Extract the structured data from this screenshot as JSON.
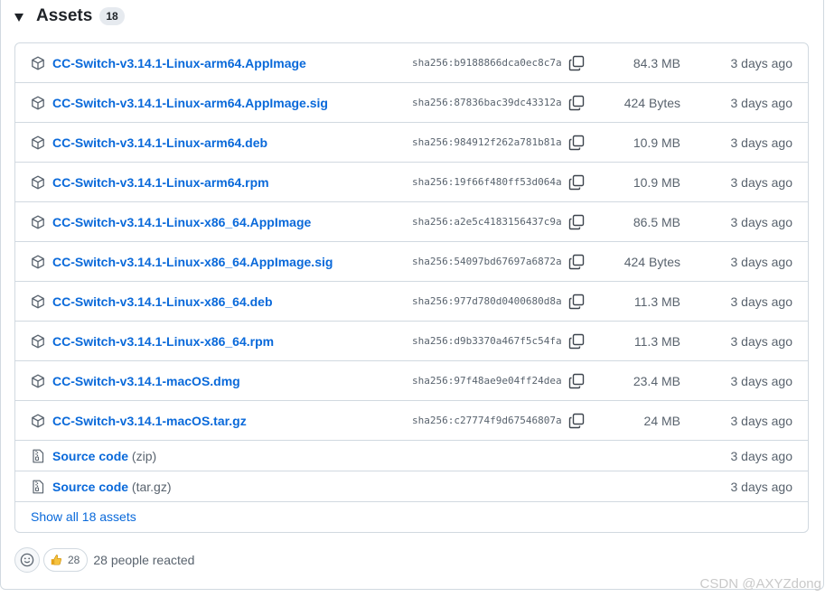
{
  "assets": {
    "title": "Assets",
    "count": "18",
    "files": [
      {
        "name": "CC-Switch-v3.14.1-Linux-arm64.AppImage",
        "sha": "sha256:b9188866dca0ec8c7a",
        "size": "84.3 MB",
        "date": "3 days ago"
      },
      {
        "name": "CC-Switch-v3.14.1-Linux-arm64.AppImage.sig",
        "sha": "sha256:87836bac39dc43312a",
        "size": "424 Bytes",
        "date": "3 days ago"
      },
      {
        "name": "CC-Switch-v3.14.1-Linux-arm64.deb",
        "sha": "sha256:984912f262a781b81a",
        "size": "10.9 MB",
        "date": "3 days ago"
      },
      {
        "name": "CC-Switch-v3.14.1-Linux-arm64.rpm",
        "sha": "sha256:19f66f480ff53d064a",
        "size": "10.9 MB",
        "date": "3 days ago"
      },
      {
        "name": "CC-Switch-v3.14.1-Linux-x86_64.AppImage",
        "sha": "sha256:a2e5c4183156437c9a",
        "size": "86.5 MB",
        "date": "3 days ago"
      },
      {
        "name": "CC-Switch-v3.14.1-Linux-x86_64.AppImage.sig",
        "sha": "sha256:54097bd67697a6872a",
        "size": "424 Bytes",
        "date": "3 days ago"
      },
      {
        "name": "CC-Switch-v3.14.1-Linux-x86_64.deb",
        "sha": "sha256:977d780d0400680d8a",
        "size": "11.3 MB",
        "date": "3 days ago"
      },
      {
        "name": "CC-Switch-v3.14.1-Linux-x86_64.rpm",
        "sha": "sha256:d9b3370a467f5c54fa",
        "size": "11.3 MB",
        "date": "3 days ago"
      },
      {
        "name": "CC-Switch-v3.14.1-macOS.dmg",
        "sha": "sha256:97f48ae9e04ff24dea",
        "size": "23.4 MB",
        "date": "3 days ago"
      },
      {
        "name": "CC-Switch-v3.14.1-macOS.tar.gz",
        "sha": "sha256:c27774f9d67546807a",
        "size": "24 MB",
        "date": "3 days ago"
      }
    ],
    "source": [
      {
        "label": "Source code",
        "format": "(zip)",
        "date": "3 days ago"
      },
      {
        "label": "Source code",
        "format": "(tar.gz)",
        "date": "3 days ago"
      }
    ],
    "show_all": "Show all 18 assets"
  },
  "reactions": {
    "thumbs_count": "28",
    "summary": "28 people reacted"
  },
  "watermark": "CSDN @AXYZdong",
  "colors": {
    "link": "#0969da",
    "muted": "#59636e",
    "border": "#d1d9e0"
  },
  "icons": {
    "toggle": "triangle-down-icon",
    "asset": "package-icon",
    "source": "file-zip-icon",
    "copy": "copy-icon",
    "reaction_add": "smiley-icon",
    "reaction": "thumbs-up-icon"
  }
}
